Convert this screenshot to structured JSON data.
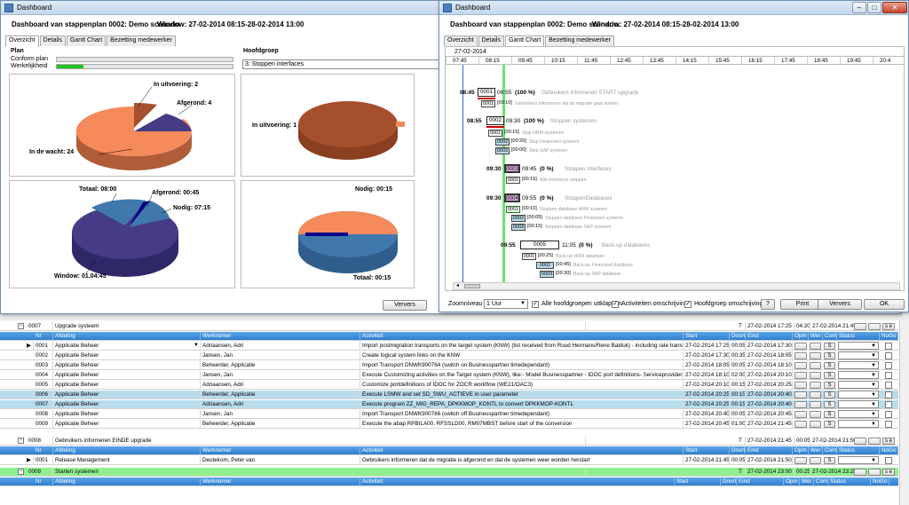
{
  "win1": {
    "title": "Dashboard",
    "header": "Dashboard van stappenplan 0002: Demo scenario.",
    "window_label": "Window: 27-02-2014 08:15-28-02-2014 13:00",
    "tabs": [
      "Overzicht",
      "Details",
      "Gantt Chart",
      "Bezetting medewerker"
    ],
    "plan": {
      "title": "Plan",
      "conform": "Conform plan",
      "werkelijkheid": "Werkelijkheid",
      "werkelijkheid_progress": 0.15
    },
    "hoofdgroep": {
      "title": "Hoofdgroep",
      "value": "3: Stoppen interfaces"
    },
    "pie1": {
      "in_uitvoering": "In uitvoering: 2",
      "afgerond": "Afgerond: 4",
      "in_de_wacht": "In de wacht: 24"
    },
    "pie2": {
      "in_uitvoering": "In uitvoering: 1"
    },
    "pie3": {
      "totaal": "Totaal: 08:00",
      "afgerond": "Afgerond: 00:45",
      "nodig": "Nodig: 07:15",
      "window": "Window: 01.04:45"
    },
    "pie4": {
      "nodig": "Nodig: 00:15",
      "totaal": "Totaal: 00:15"
    },
    "verversen": "Ververs",
    "colors": {
      "orange": "#f58a5b",
      "purple": "#463b86",
      "steel": "#3f78ad",
      "brown": "#a64f2c",
      "navy": "#00008b"
    }
  },
  "win2": {
    "title": "Dashboard",
    "header": "Dashboard van stappenplan 0002: Demo scenario.",
    "window_label": "Window: 27-02-2014 08:15-28-02-2014 13:00",
    "tabs": [
      "Overzicht",
      "Details",
      "Gantt Chart",
      "Bezetting medewerker"
    ],
    "date": "27-02-2014",
    "times": [
      "07:45",
      "08:15",
      "09:45",
      "10:15",
      "11:45",
      "12:45",
      "13:45",
      "14:15",
      "15:45",
      "16:15",
      "17:45",
      "18:45",
      "19:45",
      "20:4"
    ],
    "gantt": {
      "t1_start": "08:45",
      "t1_code": "0001",
      "t1_end": "08:55",
      "t1_pct": "(100 %)",
      "t1_desc": "Gebruikers informeren START upgrade",
      "t1_sub_code": "0001",
      "t1_sub_dur": "[00:10]",
      "t1_sub_desc": "Gebruikers informeren dat de migratie gaat starten",
      "t2_start": "08:55",
      "t2_code": "0002",
      "t2_end": "09:30",
      "t2_pct": "(100 %)",
      "t2_desc": "Stoppen systemen",
      "t2_s1_code": "0001",
      "t2_s1_dur": "[00:15]",
      "t2_s1_desc": "Stop HRM systemen",
      "t2_s2_code": "0002",
      "t2_s2_dur": "[00:20]",
      "t2_s2_desc": "Stop Financieel systeem",
      "t2_s3_code": "0003",
      "t2_s3_dur": "[00:00]",
      "t2_s3_desc": "Stop SAP systeem",
      "t3_start": "09:30",
      "t3_code": "0003",
      "t3_end": "09:45",
      "t3_pct": "(0 %)",
      "t3_desc": "Stoppen interfaces",
      "t3_s1_code": "0001",
      "t3_s1_dur": "[00:15]",
      "t3_s1_desc": "Alle interfaces stoppen",
      "t4_start": "09:30",
      "t4_code": "0004",
      "t4_end": "09:55",
      "t4_pct": "(0 %)",
      "t4_desc": "StoppenDatabases",
      "t4_s1_code": "0001",
      "t4_s1_dur": "[00:10]",
      "t4_s1_desc": "Stoppen database HRM systeem",
      "t4_s2_code": "0002",
      "t4_s2_dur": "[00:05]",
      "t4_s2_desc": "Stoppen database Financieel systeem",
      "t4_s3_code": "0003",
      "t4_s3_dur": "[00:15]",
      "t4_s3_desc": "Stoppen database SAP systeem",
      "t5_start": "09:55",
      "t5_code": "0005",
      "t5_end": "11:05",
      "t5_pct": "(0 %)",
      "t5_desc": "Back-up databases",
      "t5_s1_code": "0001",
      "t5_s1_dur": "[00:25]",
      "t5_s1_desc": "Back-up HRM database",
      "t5_s2_code": "0002",
      "t5_s2_dur": "[00:45]",
      "t5_s2_desc": "Back-up Financieel database",
      "t5_s3_code": "0003",
      "t5_s3_dur": "[00:30]",
      "t5_s3_desc": "Back-up SAP database"
    },
    "zoom_label": "Zoomniveau",
    "zoom_value": "1 Uur",
    "cb1": "Alle hoofdgroepen uitklappen",
    "cb2": "Activiteiten omschrijving",
    "cb3": "Hoofdgroep omschrijving",
    "help": "?",
    "print": "Print",
    "verversen": "Ververs",
    "ok": "OK"
  },
  "grid": {
    "g0007": {
      "code": "0007",
      "name": "Upgrade systeem",
      "t": "T",
      "start": "27-02-2014 17:25",
      "dur": "04:20",
      "end": "27-02-2014 21:45"
    },
    "headers": [
      "Nr",
      "Afdeling",
      "Werknemer",
      "Activiteit",
      "Start",
      "Doorl",
      "Eind",
      "Opm",
      "Wer",
      "Com",
      "Status",
      "NoGo"
    ],
    "rows": [
      {
        "nr": "0001",
        "afd": "Applicatie Beheer",
        "wn": "Adriaansen, Adri",
        "act": "Import postmigration transports on the target system (KNW) (list received from Ruud Hermans/Rene Balduk) - including rate transpo",
        "start": "27-02-2014 17:25",
        "dur": "00:05",
        "end": "27-02-2014 17:30"
      },
      {
        "nr": "0002",
        "afd": "Applicatie Beheer",
        "wn": "Jansen, Jan",
        "act": "Create logical system links on the KNW",
        "start": "27-02-2014 17:30",
        "dur": "00:35",
        "end": "27-02-2014 18:05"
      },
      {
        "nr": "0003",
        "afd": "Applicatie Beheer",
        "wn": "Beheerder, Applicatie",
        "act": "Import Transport DNWK900764 (switch on Businesspartner timedependant)",
        "start": "27-02-2014 18:05",
        "dur": "00:05",
        "end": "27-02-2014 18:10"
      },
      {
        "nr": "0004",
        "afd": "Applicatie Beheer",
        "wn": "Jansen, Jan",
        "act": "Execute Customizing activities on the Target system (KNW), like:- Model Businesspartner - IDOC port definitions- Serviceproviders",
        "start": "27-02-2014 18:10",
        "dur": "02:00",
        "end": "27-02-2014 20:10"
      },
      {
        "nr": "0005",
        "afd": "Applicatie Beheer",
        "wn": "Adriaansen, Adri",
        "act": "Customize portdefinitions of IDOC for ZOCR workflow (WE21/OAC3)",
        "start": "27-02-2014 20:10",
        "dur": "00:15",
        "end": "27-02-2014 20:25"
      },
      {
        "nr": "0006",
        "afd": "Applicatie Beheer",
        "wn": "Beheerder, Applicatie",
        "act": "Execute LSMW and set SD_SWU_ACTIEVE in user parameter",
        "start": "27-02-2014 20:25",
        "dur": "00:15",
        "end": "27-02-2014 20:40"
      },
      {
        "nr": "0007",
        "afd": "Applicatie Beheer",
        "wn": "Adriaansen, Adri",
        "act": "Execute program ZZ_MIG_REPA_DPKKMOP_KONTL to convert DPKKMOP-KONTL",
        "start": "27-02-2014 20:25",
        "dur": "00:15",
        "end": "27-02-2014 20:40"
      },
      {
        "nr": "0008",
        "afd": "Applicatie Beheer",
        "wn": "Jansen, Jan",
        "act": "Import Transport DNWK900766 (switch off Businesspartner timedependant)",
        "start": "27-02-2014 20:40",
        "dur": "00:05",
        "end": "27-02-2014 20:45"
      },
      {
        "nr": "0009",
        "afd": "Applicatie Beheer",
        "wn": "Beheerder, Applicatie",
        "act": "Execute the abap RPBILA00, RFSSLD00, RM07MBST before start of the conversion",
        "start": "27-02-2014 20:45",
        "dur": "01:00",
        "end": "27-02-2014 21:45"
      }
    ],
    "g0008": {
      "code": "0008",
      "name": "Gebruikers informeren EINDE upgrade",
      "t": "T",
      "start": "27-02-2014 21:45",
      "dur": "00:05",
      "end": "27-02-2014 21:50"
    },
    "row8": {
      "nr": "0001",
      "afd": "Release Management",
      "wn": "Deutekom, Peter van",
      "act": "Gebruikers informeren dat de migratie is afgerond en dat de systemen weer worden herstart",
      "start": "27-02-2014 21:45",
      "dur": "00:05",
      "end": "27-02-2014 21:50"
    },
    "g0009": {
      "code": "0009",
      "name": "Starten systemen",
      "t": "T",
      "start": "27-02-2014 23:00",
      "dur": "00:25",
      "end": "27-02-2014 23:25"
    },
    "btn_s": "S",
    "btn_se": "s e"
  }
}
